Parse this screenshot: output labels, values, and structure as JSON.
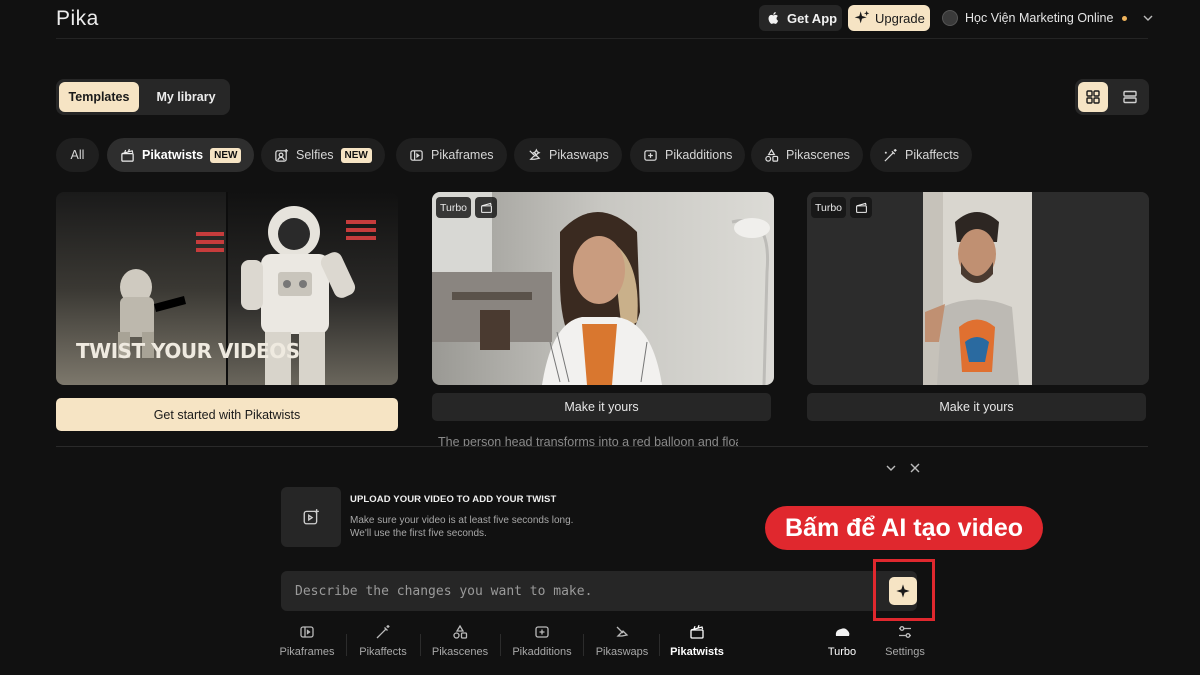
{
  "header": {
    "logo": "Pika",
    "get_app": "Get App",
    "upgrade": "Upgrade",
    "user_name": "Học Viện Marketing Online"
  },
  "tabs": {
    "templates": "Templates",
    "my_library": "My library"
  },
  "filters": [
    {
      "label": "All",
      "icon": "none"
    },
    {
      "label": "Pikatwists",
      "icon": "clapper-icon",
      "badge": "NEW"
    },
    {
      "label": "Selfies",
      "icon": "selfie-icon",
      "badge": "NEW"
    },
    {
      "label": "Pikaframes",
      "icon": "frames-icon"
    },
    {
      "label": "Pikaswaps",
      "icon": "swap-icon"
    },
    {
      "label": "Pikadditions",
      "icon": "add-icon"
    },
    {
      "label": "Pikascenes",
      "icon": "shapes-icon"
    },
    {
      "label": "Pikaffects",
      "icon": "wand-icon"
    }
  ],
  "cards": [
    {
      "overlay_text": "TWIST YOUR VIDEOS",
      "button": "Get started with Pikatwists"
    },
    {
      "tag": "Turbo",
      "button": "Make it yours",
      "prompt": "The person head transforms into a red balloon and floa"
    },
    {
      "tag": "Turbo",
      "button": "Make it yours"
    }
  ],
  "upload": {
    "title": "UPLOAD YOUR VIDEO TO ADD YOUR TWIST",
    "desc_line1": "Make sure your video is at least five seconds long.",
    "desc_line2": "We'll use the first five seconds."
  },
  "callout": "Bấm để AI tạo video",
  "prompt": {
    "placeholder": "Describe the changes you want to make."
  },
  "toolbar": {
    "items": [
      "Pikaframes",
      "Pikaffects",
      "Pikascenes",
      "Pikadditions",
      "Pikaswaps",
      "Pikatwists"
    ],
    "turbo": "Turbo",
    "settings": "Settings"
  },
  "colors": {
    "accent": "#f6e4c4",
    "callout": "#e0282e",
    "background": "#111111"
  }
}
